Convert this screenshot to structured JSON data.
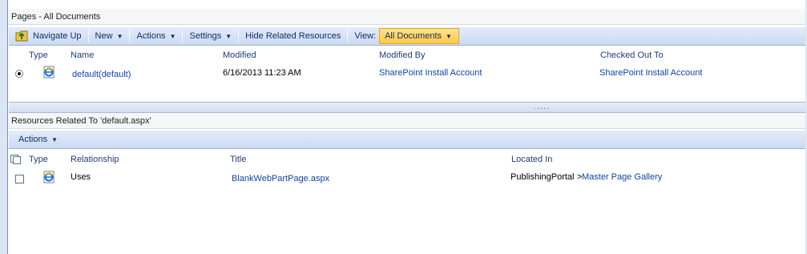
{
  "pages": {
    "title": "Pages - All Documents",
    "toolbar": {
      "navigate_up": "Navigate Up",
      "new": "New",
      "actions": "Actions",
      "settings": "Settings",
      "hide_related": "Hide Related Resources",
      "view_label": "View:",
      "view_value": "All Documents"
    },
    "columns": {
      "type": "Type",
      "name": "Name",
      "modified": "Modified",
      "modified_by": "Modified By",
      "checked_out_to": "Checked Out To"
    },
    "rows": [
      {
        "name": "default(default)",
        "modified": "6/16/2013 11:23 AM",
        "modified_by": "SharePoint Install Account",
        "checked_out_to": "SharePoint Install Account"
      }
    ]
  },
  "resources": {
    "title": "Resources Related To 'default.aspx'",
    "toolbar": {
      "actions": "Actions"
    },
    "columns": {
      "type": "Type",
      "relationship": "Relationship",
      "title": "Title",
      "located_in": "Located In"
    },
    "rows": [
      {
        "relationship": "Uses",
        "title": "BlankWebPartPage.aspx",
        "location_site": "PublishingPortal",
        "location_sep": ">",
        "location_list": "Master Page Gallery"
      }
    ]
  },
  "icons": {
    "navigate_up": "folder-up-icon",
    "page": "ie-page-icon",
    "select_all": "select-all-icon"
  },
  "colors": {
    "toolbar_blue": "#cbdaf1",
    "link_blue": "#1044a0",
    "view_highlight": "#ffc94a"
  }
}
